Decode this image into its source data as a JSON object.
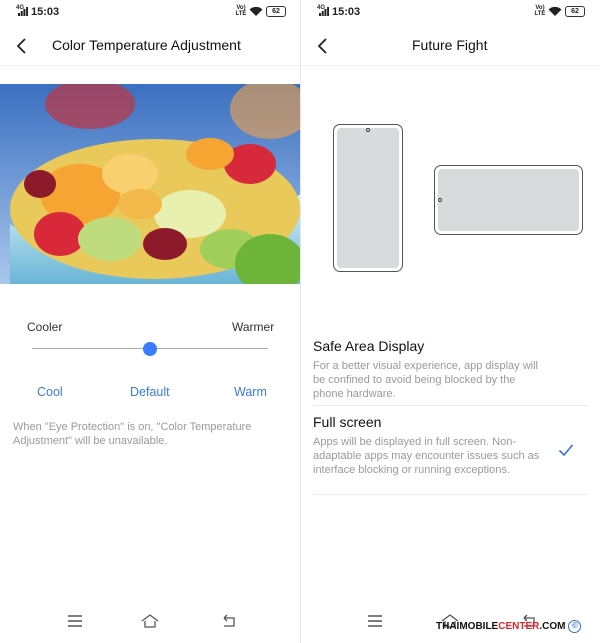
{
  "left": {
    "status": {
      "network": "4G",
      "time": "15:03",
      "volte": "Vo) LTE",
      "battery": "62"
    },
    "header": {
      "title": "Color Temperature Adjustment"
    },
    "slider": {
      "low_label": "Cooler",
      "high_label": "Warmer",
      "value_fraction": 0.5
    },
    "presets": [
      "Cool",
      "Default",
      "Warm"
    ],
    "note": "When \"Eye Protection\" is on, \"Color Temperature Adjustment\" will be unavailable."
  },
  "right": {
    "status": {
      "network": "4G",
      "time": "15:03",
      "volte": "Vo) LTE",
      "battery": "62"
    },
    "header": {
      "title": "Future Fight"
    },
    "options": [
      {
        "title": "Safe Area Display",
        "description": "For a better visual experience, app display will be confined to avoid being blocked by the phone hardware.",
        "selected": false
      },
      {
        "title": "Full screen",
        "description": "Apps will be displayed in full screen. Non-adaptable apps may encounter issues such as interface blocking or running exceptions.",
        "selected": true
      }
    ]
  },
  "watermark": {
    "main": "THAIMOBILE",
    "accent": "CENTER",
    "suffix": ".COM"
  },
  "colors": {
    "accent": "#3a7bff",
    "link": "#3a7bdc",
    "muted_text": "#9a9a9a",
    "watermark_red": "#e0262b"
  },
  "icons": [
    "signal-icon",
    "wifi-icon",
    "battery-icon",
    "back-arrow-icon",
    "menu-icon",
    "home-icon",
    "return-icon",
    "checkmark-icon",
    "copyright-icon"
  ]
}
